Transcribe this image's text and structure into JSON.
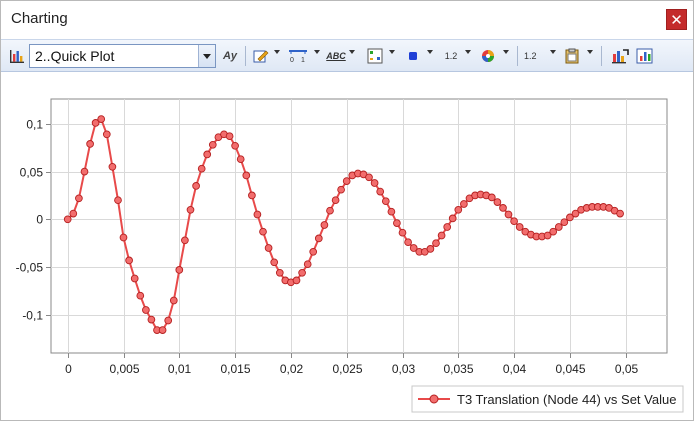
{
  "window": {
    "title": "Charting",
    "close_icon": "close-icon",
    "close_glyph": "✕"
  },
  "toolbar": {
    "plot_select": {
      "value": "2..Quick Plot"
    },
    "icons": [
      "bar-chart-icon",
      "font-style-icon",
      "edit-pen-icon",
      "axis-range-icon",
      "text-label-icon",
      "grid-icon",
      "marker-icon",
      "data-label-icon",
      "color-palette-icon",
      "cursor-icon",
      "clipboard-icon",
      "export-chart-icon",
      "properties-chart-icon"
    ],
    "font_glyph": "Ay",
    "text_label_glyph": "ABC",
    "data_label_glyph": "1.2",
    "cursor_glyph": "1.2"
  },
  "colors": {
    "series": "#e84a4a",
    "marker_fill": "#f26d6d",
    "grid": "#d9d9d9",
    "axis": "#888888",
    "close": "#c42b2b"
  },
  "chart_data": {
    "type": "line",
    "xlim": [
      -0.0015,
      0.0537
    ],
    "ylim": [
      -0.14,
      0.126
    ],
    "xticks": [
      0,
      0.005,
      0.01,
      0.015,
      0.02,
      0.025,
      0.03,
      0.035,
      0.04,
      0.045,
      0.05
    ],
    "xtick_labels": [
      "0",
      "0,005",
      "0,01",
      "0,015",
      "0,02",
      "0,025",
      "0,03",
      "0,035",
      "0,04",
      "0,045",
      "0,05"
    ],
    "yticks": [
      -0.1,
      -0.05,
      0,
      0.05,
      0.1
    ],
    "ytick_labels": [
      "-0,1",
      "-0,05",
      "0",
      "0,05",
      "0,1"
    ],
    "grid": true,
    "legend_position": "bottom-right",
    "series": [
      {
        "name": "T3 Translation (Node 44) vs Set Value",
        "x": [
          0,
          0.0005,
          0.001,
          0.0015,
          0.002,
          0.0025,
          0.003,
          0.0035,
          0.004,
          0.0045,
          0.005,
          0.0055,
          0.006,
          0.0065,
          0.007,
          0.0075,
          0.008,
          0.0085,
          0.009,
          0.0095,
          0.01,
          0.0105,
          0.011,
          0.0115,
          0.012,
          0.0125,
          0.013,
          0.0135,
          0.014,
          0.0145,
          0.015,
          0.0155,
          0.016,
          0.0165,
          0.017,
          0.0175,
          0.018,
          0.0185,
          0.019,
          0.0195,
          0.02,
          0.0205,
          0.021,
          0.0215,
          0.022,
          0.0225,
          0.023,
          0.0235,
          0.024,
          0.0245,
          0.025,
          0.0255,
          0.026,
          0.0265,
          0.027,
          0.0275,
          0.028,
          0.0285,
          0.029,
          0.0295,
          0.03,
          0.0305,
          0.031,
          0.0315,
          0.032,
          0.0325,
          0.033,
          0.0335,
          0.034,
          0.0345,
          0.035,
          0.0355,
          0.036,
          0.0365,
          0.037,
          0.0375,
          0.038,
          0.0385,
          0.039,
          0.0395,
          0.04,
          0.0405,
          0.041,
          0.0415,
          0.042,
          0.0425,
          0.043,
          0.0435,
          0.044,
          0.0445,
          0.045,
          0.0455,
          0.046,
          0.0465,
          0.047,
          0.0475,
          0.048,
          0.0485,
          0.049,
          0.0495
        ],
        "y": [
          0,
          0.006,
          0.022,
          0.05,
          0.079,
          0.101,
          0.105,
          0.089,
          0.055,
          0.02,
          -0.019,
          -0.043,
          -0.062,
          -0.08,
          -0.095,
          -0.105,
          -0.116,
          -0.116,
          -0.106,
          -0.085,
          -0.053,
          -0.022,
          0.01,
          0.035,
          0.053,
          0.068,
          0.078,
          0.086,
          0.089,
          0.087,
          0.077,
          0.063,
          0.046,
          0.025,
          0.005,
          -0.013,
          -0.03,
          -0.045,
          -0.056,
          -0.064,
          -0.066,
          -0.064,
          -0.056,
          -0.047,
          -0.034,
          -0.02,
          -0.006,
          0.009,
          0.02,
          0.031,
          0.04,
          0.046,
          0.048,
          0.047,
          0.044,
          0.038,
          0.029,
          0.019,
          0.008,
          -0.004,
          -0.014,
          -0.024,
          -0.03,
          -0.034,
          -0.034,
          -0.031,
          -0.025,
          -0.017,
          -0.008,
          0.001,
          0.01,
          0.016,
          0.022,
          0.025,
          0.026,
          0.025,
          0.023,
          0.018,
          0.012,
          0.005,
          -0.002,
          -0.008,
          -0.013,
          -0.016,
          -0.018,
          -0.018,
          -0.017,
          -0.013,
          -0.008,
          -0.003,
          0.002,
          0.006,
          0.01,
          0.012,
          0.013,
          0.013,
          0.013,
          0.012,
          0.009,
          0.006
        ]
      }
    ]
  }
}
